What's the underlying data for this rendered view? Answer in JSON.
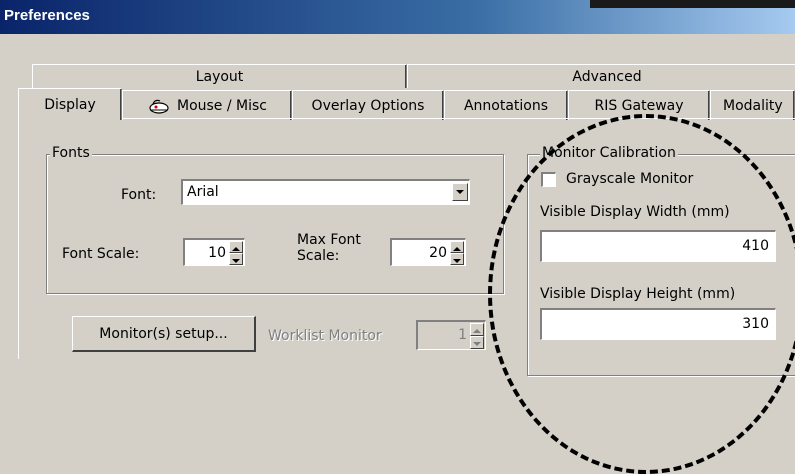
{
  "window": {
    "title": "Preferences"
  },
  "tabs": {
    "row1": [
      {
        "label": "Layout"
      },
      {
        "label": "Advanced"
      }
    ],
    "row2": [
      {
        "label": "Display"
      },
      {
        "label": "Mouse / Misc"
      },
      {
        "label": "Overlay Options"
      },
      {
        "label": "Annotations"
      },
      {
        "label": "RIS Gateway"
      },
      {
        "label": "Modality"
      }
    ],
    "active": "Display"
  },
  "fonts": {
    "legend": "Fonts",
    "font_label": "Font:",
    "font_value": "Arial",
    "font_scale_label": "Font Scale:",
    "font_scale_value": "10",
    "max_font_label_line1": "Max Font",
    "max_font_label_line2": "Scale:",
    "max_font_value": "20"
  },
  "buttons": {
    "monitor_setup": "Monitor(s) setup..."
  },
  "worklist": {
    "label": "Worklist Monitor",
    "value": "1"
  },
  "calibration": {
    "legend": "Monitor Calibration",
    "grayscale_label": "Grayscale Monitor",
    "grayscale_checked": false,
    "width_label": "Visible Display Width (mm)",
    "width_value": "410",
    "height_label": "Visible Display Height (mm)",
    "height_value": "310"
  },
  "icons": {
    "mouse_tab": "mouse-icon",
    "dropdown": "chevron-down-icon",
    "spin": "spin-arrows-icon"
  },
  "colors": {
    "dialog_bg": "#d4d0c8",
    "title_start": "#0a246a",
    "title_end": "#a6caf0"
  }
}
